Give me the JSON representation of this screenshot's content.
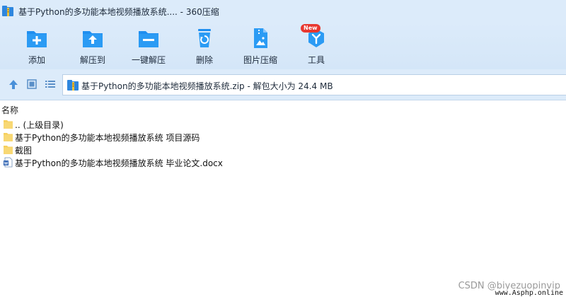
{
  "window": {
    "title": "基于Python的多功能本地视频播放系统.... - 360压缩"
  },
  "toolbar": {
    "items": [
      {
        "label": "添加",
        "icon": "add-file-icon"
      },
      {
        "label": "解压到",
        "icon": "extract-to-icon"
      },
      {
        "label": "一键解压",
        "icon": "one-click-extract-icon"
      },
      {
        "label": "删除",
        "icon": "delete-icon"
      },
      {
        "label": "图片压缩",
        "icon": "image-compress-icon"
      },
      {
        "label": "工具",
        "icon": "tools-icon"
      }
    ],
    "new_badge": "New"
  },
  "addressbar": {
    "path": "基于Python的多功能本地视频播放系统.zip - 解包大小为 24.4 MB"
  },
  "list": {
    "column_name": "名称",
    "rows": [
      {
        "name": ".. (上级目录)",
        "type": "folder"
      },
      {
        "name": "基于Python的多功能本地视频播放系统 项目源码",
        "type": "folder"
      },
      {
        "name": "截图",
        "type": "folder"
      },
      {
        "name": "基于Python的多功能本地视频播放系统 毕业论文.docx",
        "type": "docx"
      }
    ]
  },
  "watermark": {
    "csdn": "CSDN @biyezuopinvip",
    "site": "www.Asphp.online"
  },
  "colors": {
    "accent": "#1f8ff0",
    "chrome": "#dcebfa",
    "folder": "#f6cf5c",
    "badge": "#e8372f"
  }
}
